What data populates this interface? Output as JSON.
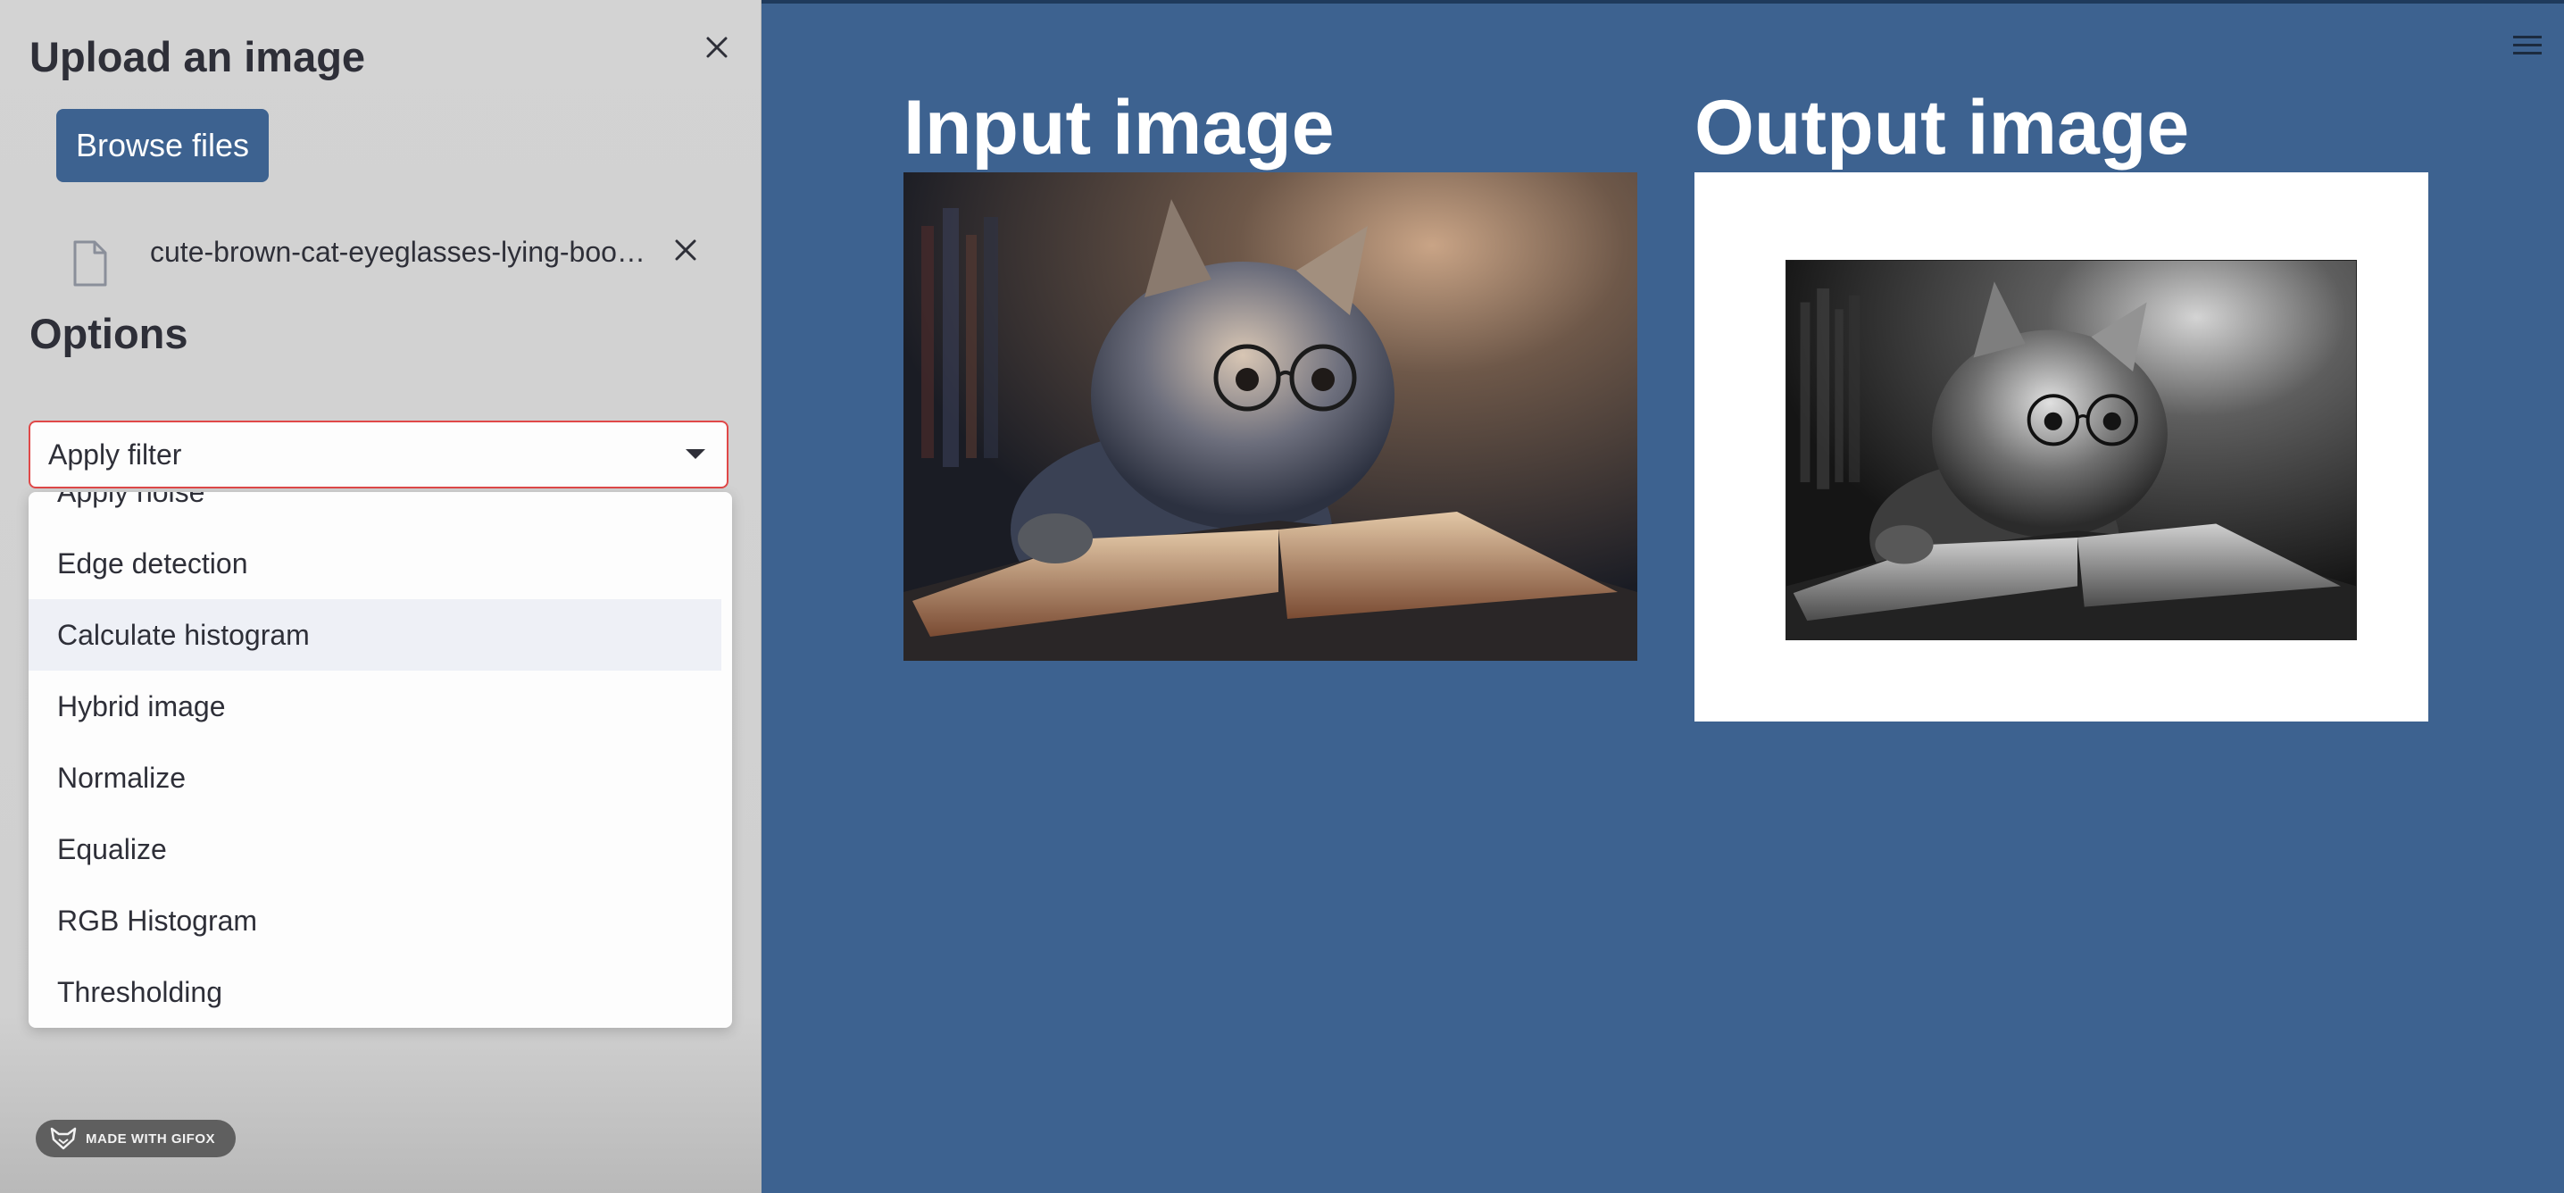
{
  "sidebar": {
    "title": "Upload an image",
    "browse_label": "Browse files",
    "file_name": "cute-brown-cat-eyeglasses-lying-book-c...",
    "options_title": "Options",
    "select_value": "Apply filter",
    "dropdown_items": [
      "Apply noise",
      "Edge detection",
      "Calculate histogram",
      "Hybrid image",
      "Normalize",
      "Equalize",
      "RGB Histogram",
      "Thresholding"
    ],
    "highlighted_item": "Calculate histogram",
    "badge_text": "MADE WITH GIFOX"
  },
  "main": {
    "input_title": "Input image",
    "output_title": "Output image"
  },
  "colors": {
    "main_bg": "#3d6290",
    "sidebar_bg": "#d3d3d3",
    "select_border": "#e04848",
    "button_bg": "#3d6290"
  },
  "icons": [
    "close-icon",
    "file-icon",
    "remove-file-icon",
    "chevron-down-icon",
    "fox-icon",
    "hamburger-menu-icon"
  ]
}
